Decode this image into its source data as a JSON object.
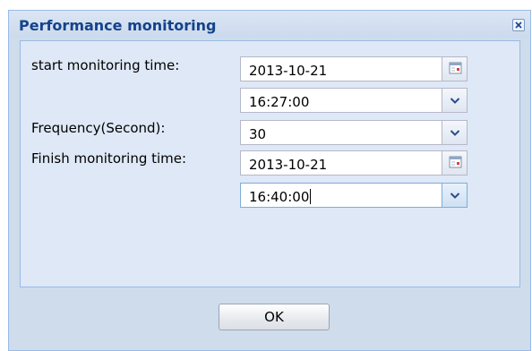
{
  "dialog": {
    "title": "Performance monitoring",
    "close_icon": "close-icon"
  },
  "form": {
    "start_label": "start monitoring time:",
    "start_date": "2013-10-21",
    "start_time": "16:27:00",
    "frequency_label": "Frequency(Second):",
    "frequency": "30",
    "finish_label": "Finish monitoring time:",
    "finish_date": "2013-10-21",
    "finish_time": "16:40:00"
  },
  "icons": {
    "calendar": "calendar-icon",
    "dropdown": "chevron-down-icon"
  },
  "buttons": {
    "ok": "OK"
  },
  "colors": {
    "title_text": "#15428b",
    "window_bg": "#cfdcec",
    "panel_bg": "#dfe8f6",
    "border": "#99bbe8"
  }
}
